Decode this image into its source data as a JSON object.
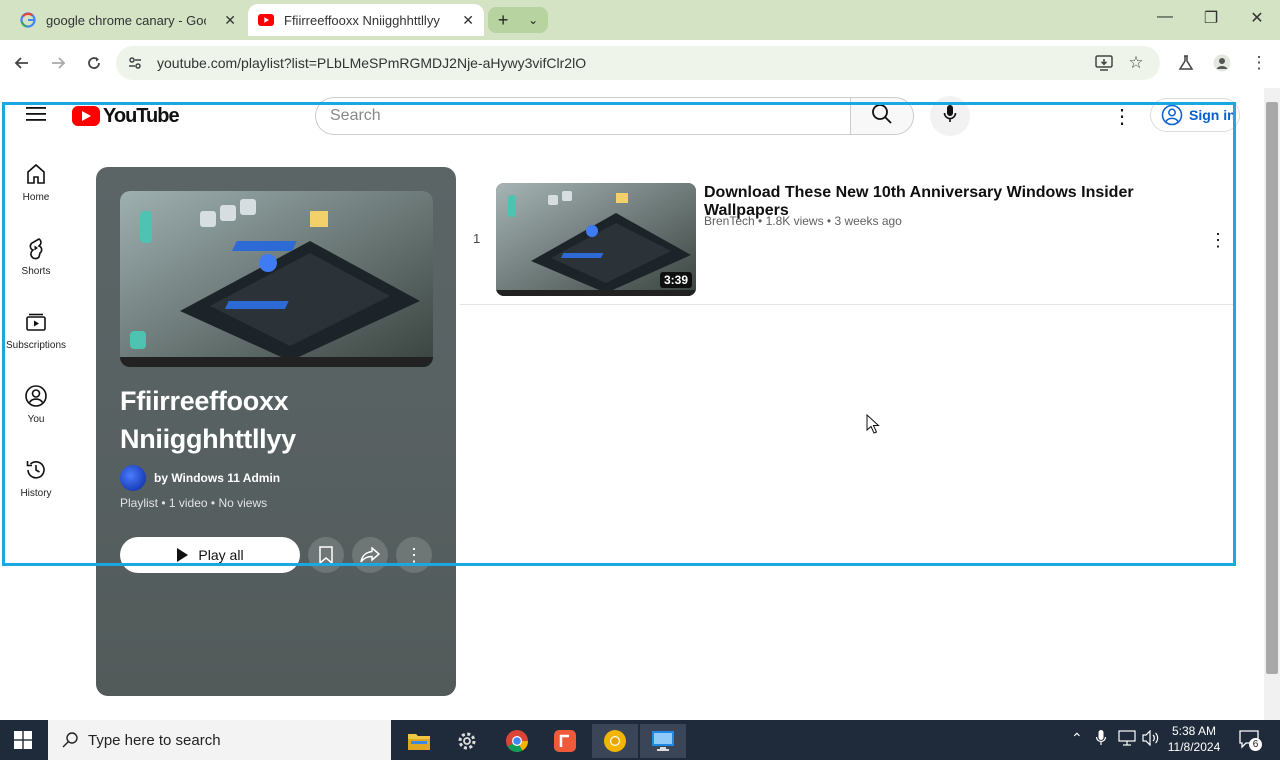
{
  "browser": {
    "tabs": [
      {
        "title": "google chrome canary - Google",
        "favicon": "google-g-icon",
        "active": false
      },
      {
        "title": "Ffiirreeffooxx Nniigghhttllyy - Y",
        "favicon": "youtube-icon",
        "active": true
      }
    ],
    "url": "youtube.com/playlist?list=PLbLMeSPmRGMDJ2Nje-aHywy3vifClr2lO"
  },
  "youtube": {
    "logo_text": "YouTube",
    "search_placeholder": "Search",
    "sign_in": "Sign in",
    "nav": [
      {
        "label": "Home",
        "icon": "home-icon"
      },
      {
        "label": "Shorts",
        "icon": "shorts-icon"
      },
      {
        "label": "Subscriptions",
        "icon": "subscriptions-icon"
      },
      {
        "label": "You",
        "icon": "you-icon"
      },
      {
        "label": "History",
        "icon": "history-icon"
      }
    ],
    "playlist": {
      "title": "Ffiirreeffooxx Nniigghhttllyy",
      "owner": "by Windows 11 Admin",
      "meta": "Playlist • 1 video • No views",
      "play_all": "Play all"
    },
    "videos": [
      {
        "index": "1",
        "title": "Download These New 10th Anniversary Windows Insider Wallpapers",
        "meta": "BrenTech • 1.8K views • 3 weeks ago",
        "duration": "3:39"
      }
    ]
  },
  "taskbar": {
    "search_placeholder": "Type here to search",
    "time": "5:38 AM",
    "date": "11/8/2024",
    "notification_count": "6"
  },
  "colors": {
    "accent_highlight": "#1ba7e0",
    "youtube_red": "#ff0000",
    "chrome_tabbar": "#d3e3c4"
  }
}
